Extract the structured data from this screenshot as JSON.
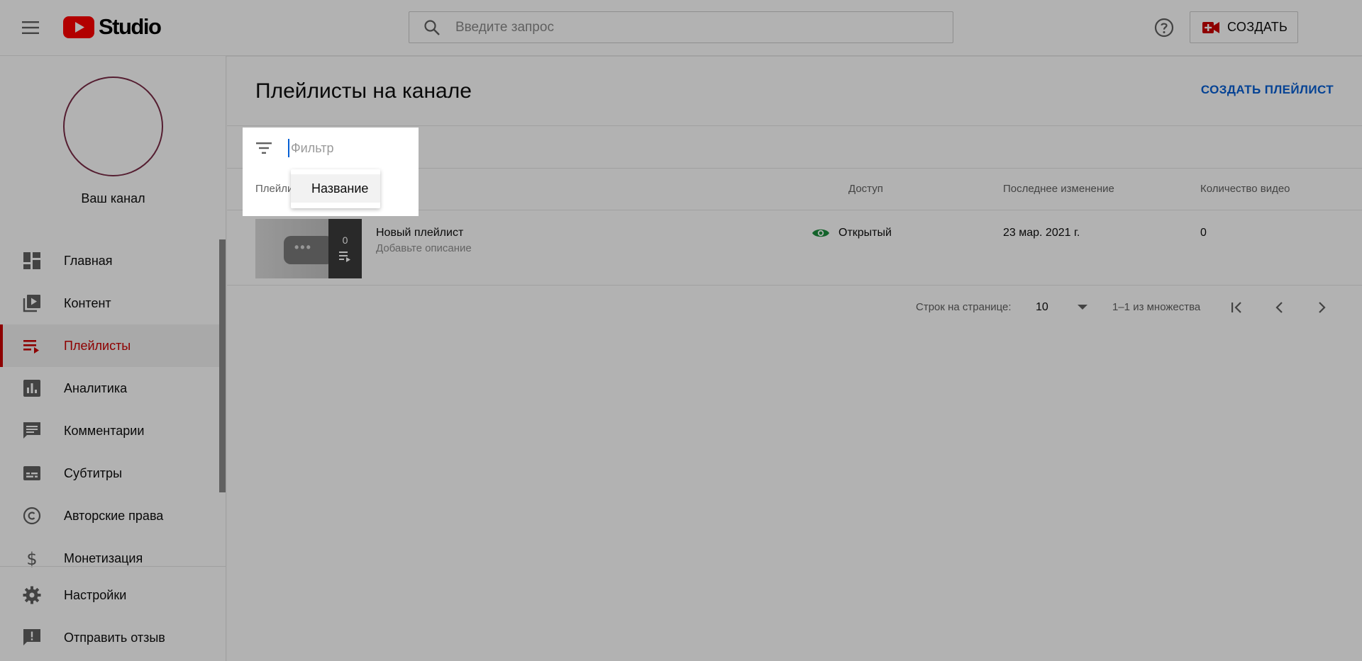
{
  "header": {
    "logo_text": "Studio",
    "search_placeholder": "Введите запрос",
    "create_label": "СОЗДАТЬ"
  },
  "sidebar": {
    "channel_name": "Ваш канал",
    "items": [
      {
        "label": "Главная",
        "icon": "dashboard-icon",
        "active": false
      },
      {
        "label": "Контент",
        "icon": "content-icon",
        "active": false
      },
      {
        "label": "Плейлисты",
        "icon": "playlists-icon",
        "active": true
      },
      {
        "label": "Аналитика",
        "icon": "analytics-icon",
        "active": false
      },
      {
        "label": "Комментарии",
        "icon": "comments-icon",
        "active": false
      },
      {
        "label": "Субтитры",
        "icon": "subtitles-icon",
        "active": false
      },
      {
        "label": "Авторские права",
        "icon": "copyright-icon",
        "active": false
      },
      {
        "label": "Монетизация",
        "icon": "monetization-icon",
        "active": false
      }
    ],
    "bottom_items": [
      {
        "label": "Настройки",
        "icon": "settings-icon"
      },
      {
        "label": "Отправить отзыв",
        "icon": "feedback-icon"
      }
    ]
  },
  "main": {
    "title": "Плейлисты на канале",
    "create_playlist_label": "СОЗДАТЬ ПЛЕЙЛИСТ",
    "filter": {
      "placeholder": "Фильтр",
      "dropdown_option": "Название"
    },
    "columns": {
      "playlist": "Плейли",
      "access": "Доступ",
      "last_modified": "Последнее изменение",
      "video_count": "Количество видео"
    },
    "rows": [
      {
        "title": "Новый плейлист",
        "description": "Добавьте описание",
        "thumb_count": "0",
        "access": "Открытый",
        "last_modified": "23 мар. 2021 г.",
        "video_count": "0"
      }
    ],
    "pagination": {
      "rows_per_page_label": "Строк на странице:",
      "rows_per_page_value": "10",
      "range_label": "1–1 из множества"
    }
  },
  "colors": {
    "brand_red": "#cc0000",
    "link_blue": "#065fd4",
    "access_green": "#1e8e3e"
  }
}
